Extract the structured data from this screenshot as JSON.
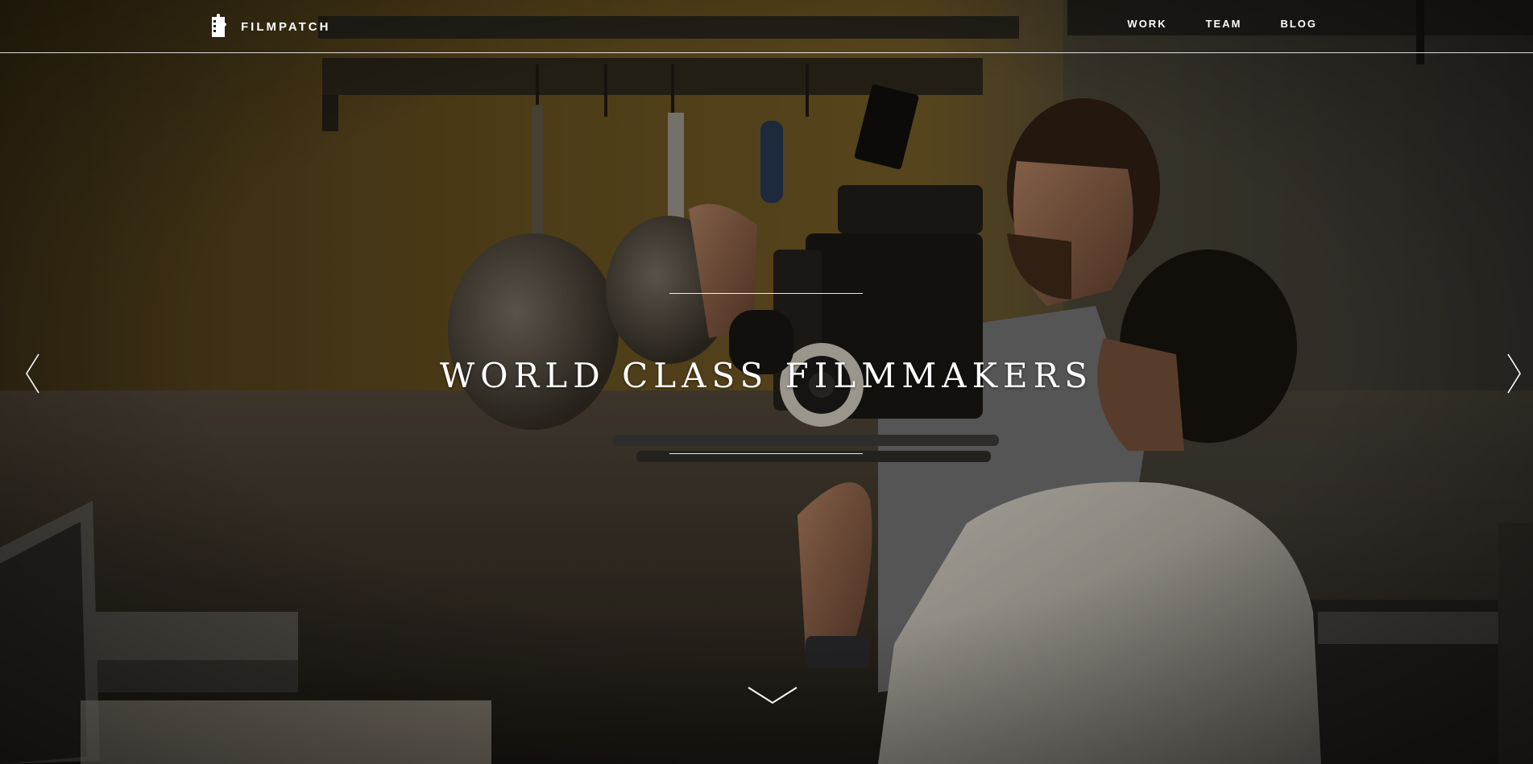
{
  "header": {
    "logo_text": "FILMPATCH",
    "nav": [
      {
        "label": "WORK"
      },
      {
        "label": "TEAM"
      },
      {
        "label": "BLOG"
      }
    ]
  },
  "hero": {
    "headline": "WORLD CLASS FILMMAKERS"
  },
  "icons": {
    "logo": "filmpatch-logo-icon",
    "prev": "chevron-left-icon",
    "next": "chevron-right-icon",
    "scroll": "chevron-down-icon"
  },
  "colors": {
    "text": "#ffffff",
    "wall_upper": "#5c4a1f",
    "wall_lower": "#3b3328",
    "shirt_white": "#d8d4cc"
  }
}
